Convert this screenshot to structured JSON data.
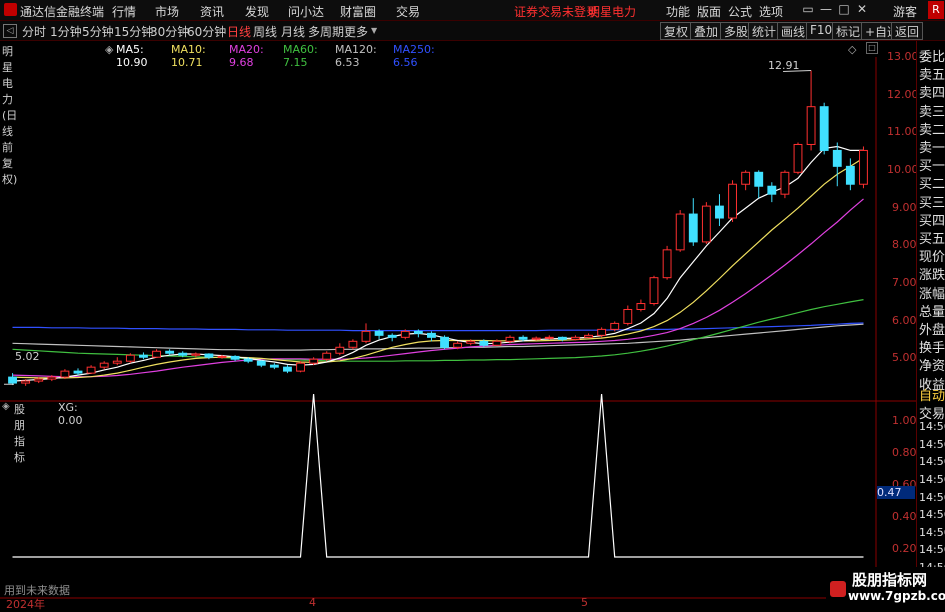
{
  "app": {
    "title": "通达信金融终端",
    "warning": "证券交易未登录",
    "stock": "明星电力"
  },
  "menu": [
    "行情",
    "市场",
    "资讯",
    "发现",
    "问小达",
    "财富圈",
    "交易"
  ],
  "right_menu": [
    "功能",
    "版面",
    "公式",
    "选项"
  ],
  "guest": "游客",
  "tabs": [
    "分时",
    "1分钟",
    "5分钟",
    "15分钟",
    "30分钟",
    "60分钟",
    "日线",
    "周线",
    "月线",
    "多周期",
    "更多"
  ],
  "active_tab": "日线",
  "tools": [
    "复权",
    "叠加",
    "多股",
    "统计",
    "画线",
    "F10",
    "标记",
    "+自选",
    "返回"
  ],
  "legend": {
    "name": "明星电力(日线 前复权)",
    "ma5": "MA5: 10.90",
    "ma10": "MA10: 10.71",
    "ma20": "MA20: 9.68",
    "ma60": "MA60: 7.15",
    "ma120": "MA120: 6.53",
    "ma250": "MA250: 6.56"
  },
  "colors": {
    "ma5": "#ffffff",
    "ma10": "#f0e060",
    "ma20": "#e040e0",
    "ma60": "#40c040",
    "ma120": "#c0c0c0",
    "ma250": "#3050ff",
    "up": "#ff3030",
    "down": "#40e0ff",
    "axis": "#c03030"
  },
  "price_axis": [
    "13.00",
    "12.00",
    "11.00",
    "10.00",
    "9.00",
    "8.00",
    "7.00",
    "6.00",
    "5.00"
  ],
  "high_label": "12.91",
  "low_label": "5.02",
  "side_panel": [
    "委比",
    "卖五",
    "卖四",
    "卖三",
    "卖二",
    "卖一",
    "买一",
    "买二",
    "买三",
    "买四",
    "买五",
    "现价",
    "涨跌",
    "涨幅",
    "总量",
    "外盘",
    "换手",
    "净资",
    "收益"
  ],
  "indicator": {
    "name": "股朋指标",
    "value": "XG: 0.00",
    "axis": [
      "1.00",
      "0.80",
      "0.60",
      "0.40",
      "0.20"
    ],
    "marker": "0.47",
    "note": "用到未来数据"
  },
  "side_panel2": [
    "自动",
    "交易",
    "14:56",
    "14:56",
    "14:56",
    "14:56",
    "14:56",
    "14:56",
    "14:56",
    "14:56",
    "14:56",
    "14:56"
  ],
  "xaxis": [
    "2024年",
    "4",
    "5"
  ],
  "watermark": {
    "title": "股朋指标网",
    "url": "www.7gpzb.com"
  },
  "chart_data": {
    "type": "line",
    "title": "",
    "ylim": [
      4.8,
      13.3
    ],
    "candles": [
      [
        5.2,
        5.05,
        5.3,
        5.0
      ],
      [
        5.05,
        5.1,
        5.15,
        4.98
      ],
      [
        5.1,
        5.15,
        5.2,
        5.05
      ],
      [
        5.15,
        5.2,
        5.25,
        5.1
      ],
      [
        5.2,
        5.35,
        5.4,
        5.15
      ],
      [
        5.35,
        5.3,
        5.42,
        5.25
      ],
      [
        5.3,
        5.45,
        5.5,
        5.28
      ],
      [
        5.45,
        5.55,
        5.6,
        5.4
      ],
      [
        5.55,
        5.6,
        5.7,
        5.5
      ],
      [
        5.6,
        5.75,
        5.8,
        5.55
      ],
      [
        5.75,
        5.7,
        5.82,
        5.65
      ],
      [
        5.7,
        5.85,
        5.9,
        5.68
      ],
      [
        5.85,
        5.8,
        5.9,
        5.75
      ],
      [
        5.8,
        5.75,
        5.85,
        5.7
      ],
      [
        5.75,
        5.78,
        5.82,
        5.7
      ],
      [
        5.78,
        5.7,
        5.8,
        5.65
      ],
      [
        5.7,
        5.72,
        5.76,
        5.66
      ],
      [
        5.72,
        5.65,
        5.75,
        5.6
      ],
      [
        5.65,
        5.6,
        5.7,
        5.55
      ],
      [
        5.6,
        5.5,
        5.62,
        5.45
      ],
      [
        5.5,
        5.45,
        5.55,
        5.4
      ],
      [
        5.45,
        5.35,
        5.5,
        5.3
      ],
      [
        5.35,
        5.55,
        5.6,
        5.32
      ],
      [
        5.55,
        5.65,
        5.7,
        5.5
      ],
      [
        5.65,
        5.8,
        5.85,
        5.6
      ],
      [
        5.8,
        5.95,
        6.05,
        5.75
      ],
      [
        5.95,
        6.1,
        6.15,
        5.9
      ],
      [
        6.1,
        6.35,
        6.55,
        6.05
      ],
      [
        6.35,
        6.25,
        6.4,
        6.15
      ],
      [
        6.25,
        6.2,
        6.3,
        6.1
      ],
      [
        6.2,
        6.35,
        6.4,
        6.15
      ],
      [
        6.35,
        6.3,
        6.4,
        6.2
      ],
      [
        6.3,
        6.2,
        6.35,
        6.1
      ],
      [
        6.2,
        5.95,
        6.25,
        5.9
      ],
      [
        5.95,
        6.05,
        6.1,
        5.9
      ],
      [
        6.05,
        6.1,
        6.15,
        6.0
      ],
      [
        6.1,
        6.0,
        6.15,
        5.95
      ],
      [
        6.0,
        6.1,
        6.15,
        5.98
      ],
      [
        6.1,
        6.2,
        6.25,
        6.05
      ],
      [
        6.2,
        6.15,
        6.25,
        6.1
      ],
      [
        6.15,
        6.18,
        6.22,
        6.12
      ],
      [
        6.18,
        6.2,
        6.25,
        6.15
      ],
      [
        6.2,
        6.15,
        6.22,
        6.1
      ],
      [
        6.15,
        6.2,
        6.25,
        6.12
      ],
      [
        6.2,
        6.25,
        6.3,
        6.18
      ],
      [
        6.25,
        6.4,
        6.45,
        6.2
      ],
      [
        6.4,
        6.55,
        6.6,
        6.35
      ],
      [
        6.55,
        6.9,
        7.0,
        6.5
      ],
      [
        6.9,
        7.05,
        7.15,
        6.85
      ],
      [
        7.05,
        7.7,
        7.75,
        7.0
      ],
      [
        7.7,
        8.4,
        8.5,
        7.65
      ],
      [
        8.4,
        9.3,
        9.4,
        8.35
      ],
      [
        9.3,
        8.6,
        9.7,
        8.5
      ],
      [
        8.6,
        9.5,
        9.6,
        8.55
      ],
      [
        9.5,
        9.2,
        9.8,
        9.0
      ],
      [
        9.2,
        10.05,
        10.15,
        9.1
      ],
      [
        10.05,
        10.35,
        10.4,
        9.9
      ],
      [
        10.35,
        10.0,
        10.4,
        9.7
      ],
      [
        10.0,
        9.8,
        10.1,
        9.6
      ],
      [
        9.8,
        10.35,
        10.4,
        9.7
      ],
      [
        10.35,
        11.05,
        11.1,
        10.3
      ],
      [
        11.05,
        12.0,
        12.91,
        10.9
      ],
      [
        12.0,
        10.9,
        12.1,
        10.8
      ],
      [
        10.9,
        10.5,
        11.1,
        10.0
      ],
      [
        10.5,
        10.05,
        10.7,
        9.9
      ],
      [
        10.05,
        10.9,
        11.0,
        9.95
      ]
    ],
    "ma5": [
      5.1,
      5.12,
      5.14,
      5.16,
      5.2,
      5.25,
      5.3,
      5.38,
      5.45,
      5.55,
      5.62,
      5.7,
      5.75,
      5.78,
      5.78,
      5.76,
      5.74,
      5.71,
      5.67,
      5.62,
      5.58,
      5.52,
      5.5,
      5.52,
      5.58,
      5.68,
      5.82,
      6.0,
      6.13,
      6.22,
      6.28,
      6.3,
      6.26,
      6.19,
      6.12,
      6.07,
      6.04,
      6.05,
      6.08,
      6.11,
      6.14,
      6.16,
      6.17,
      6.18,
      6.2,
      6.24,
      6.3,
      6.42,
      6.56,
      6.8,
      7.18,
      7.7,
      8.1,
      8.5,
      8.85,
      9.2,
      9.45,
      9.7,
      9.85,
      9.98,
      10.2,
      10.6,
      10.95,
      11.0,
      10.9,
      10.9
    ],
    "ma10": [
      5.2,
      5.19,
      5.18,
      5.18,
      5.18,
      5.19,
      5.21,
      5.25,
      5.3,
      5.37,
      5.45,
      5.52,
      5.58,
      5.63,
      5.67,
      5.69,
      5.7,
      5.7,
      5.69,
      5.67,
      5.64,
      5.61,
      5.58,
      5.57,
      5.58,
      5.61,
      5.67,
      5.75,
      5.85,
      5.95,
      6.02,
      6.08,
      6.11,
      6.12,
      6.12,
      6.12,
      6.12,
      6.11,
      6.11,
      6.11,
      6.11,
      6.12,
      6.13,
      6.14,
      6.16,
      6.18,
      6.22,
      6.28,
      6.36,
      6.47,
      6.62,
      6.83,
      7.08,
      7.37,
      7.68,
      8.0,
      8.3,
      8.6,
      8.9,
      9.17,
      9.45,
      9.75,
      10.05,
      10.3,
      10.5,
      10.71
    ],
    "ma20": [
      5.25,
      5.24,
      5.23,
      5.22,
      5.21,
      5.21,
      5.21,
      5.22,
      5.24,
      5.27,
      5.31,
      5.35,
      5.4,
      5.45,
      5.49,
      5.53,
      5.57,
      5.6,
      5.63,
      5.65,
      5.66,
      5.66,
      5.66,
      5.65,
      5.65,
      5.65,
      5.66,
      5.68,
      5.71,
      5.75,
      5.79,
      5.83,
      5.87,
      5.9,
      5.93,
      5.96,
      5.98,
      6.0,
      6.02,
      6.03,
      6.04,
      6.05,
      6.06,
      6.07,
      6.08,
      6.1,
      6.12,
      6.15,
      6.19,
      6.25,
      6.32,
      6.42,
      6.55,
      6.7,
      6.88,
      7.08,
      7.3,
      7.53,
      7.77,
      8.02,
      8.28,
      8.55,
      8.83,
      9.1,
      9.4,
      9.68
    ],
    "ma60": [
      5.9,
      5.88,
      5.86,
      5.84,
      5.82,
      5.8,
      5.79,
      5.78,
      5.77,
      5.76,
      5.75,
      5.74,
      5.73,
      5.72,
      5.71,
      5.7,
      5.69,
      5.68,
      5.67,
      5.66,
      5.65,
      5.64,
      5.63,
      5.62,
      5.61,
      5.6,
      5.6,
      5.6,
      5.6,
      5.6,
      5.61,
      5.61,
      5.61,
      5.62,
      5.62,
      5.63,
      5.63,
      5.64,
      5.64,
      5.65,
      5.66,
      5.67,
      5.68,
      5.69,
      5.71,
      5.73,
      5.76,
      5.8,
      5.85,
      5.91,
      5.98,
      6.06,
      6.14,
      6.22,
      6.31,
      6.4,
      6.49,
      6.58,
      6.66,
      6.74,
      6.82,
      6.9,
      6.97,
      7.03,
      7.09,
      7.15
    ],
    "ma120": [
      6.05,
      6.04,
      6.03,
      6.02,
      6.01,
      6.0,
      5.99,
      5.98,
      5.97,
      5.96,
      5.95,
      5.94,
      5.93,
      5.92,
      5.91,
      5.9,
      5.89,
      5.89,
      5.88,
      5.88,
      5.88,
      5.88,
      5.88,
      5.89,
      5.89,
      5.9,
      5.9,
      5.91,
      5.91,
      5.92,
      5.92,
      5.93,
      5.93,
      5.94,
      5.94,
      5.95,
      5.95,
      5.96,
      5.97,
      5.97,
      5.98,
      5.99,
      6.0,
      6.01,
      6.02,
      6.03,
      6.04,
      6.05,
      6.07,
      6.09,
      6.11,
      6.13,
      6.16,
      6.19,
      6.22,
      6.25,
      6.28,
      6.31,
      6.34,
      6.37,
      6.4,
      6.43,
      6.46,
      6.49,
      6.51,
      6.53
    ],
    "ma250": [
      6.45,
      6.45,
      6.45,
      6.44,
      6.44,
      6.44,
      6.43,
      6.43,
      6.43,
      6.42,
      6.42,
      6.42,
      6.41,
      6.41,
      6.41,
      6.4,
      6.4,
      6.4,
      6.39,
      6.39,
      6.39,
      6.38,
      6.38,
      6.38,
      6.38,
      6.38,
      6.37,
      6.37,
      6.37,
      6.37,
      6.37,
      6.37,
      6.37,
      6.37,
      6.37,
      6.37,
      6.37,
      6.37,
      6.37,
      6.37,
      6.37,
      6.38,
      6.38,
      6.38,
      6.38,
      6.38,
      6.39,
      6.39,
      6.39,
      6.4,
      6.4,
      6.41,
      6.41,
      6.42,
      6.43,
      6.44,
      6.45,
      6.46,
      6.47,
      6.48,
      6.49,
      6.5,
      6.52,
      6.53,
      6.55,
      6.56
    ],
    "xg": {
      "spikes": [
        23,
        45
      ],
      "ylim": [
        0,
        1
      ]
    }
  }
}
